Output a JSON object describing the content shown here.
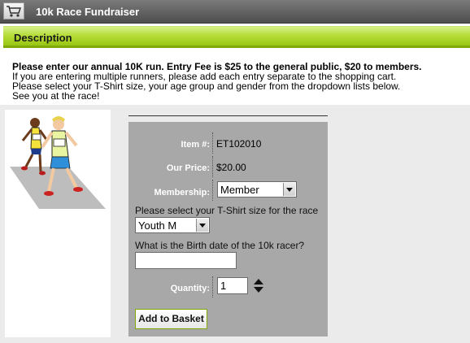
{
  "header": {
    "title": "10k Race Fundraiser",
    "icon": "cart-icon"
  },
  "section": {
    "title": "Description"
  },
  "intro": {
    "headline": "Please enter our annual 10K run. Entry Fee is $25 to the general public, $20 to members.",
    "line1": "If you are entering multiple runners, please add each entry separate to the shopping cart.",
    "line2": "Please select your T-Shirt size, your age group and gender from the dropdown lists below.",
    "line3": "See you at the race!"
  },
  "image": {
    "description_icon": "runners-image"
  },
  "product": {
    "item_label": "Item #:",
    "item_value": "ET102010",
    "price_label": "Our Price:",
    "price_value": "$20.00",
    "membership_label": "Membership:",
    "membership_value": "Member",
    "tshirt_label": "Please select your T-Shirt size for the race",
    "tshirt_value": "Youth M",
    "birthdate_label": "What is the Birth date of the 10k racer?",
    "birthdate_value": "",
    "quantity_label": "Quantity:",
    "quantity_value": "1",
    "add_button": "Add to Basket"
  },
  "colors": {
    "accent_green": "#98c611",
    "panel_gray": "#a8a8a8",
    "titlebar": "#5a5a5a"
  }
}
